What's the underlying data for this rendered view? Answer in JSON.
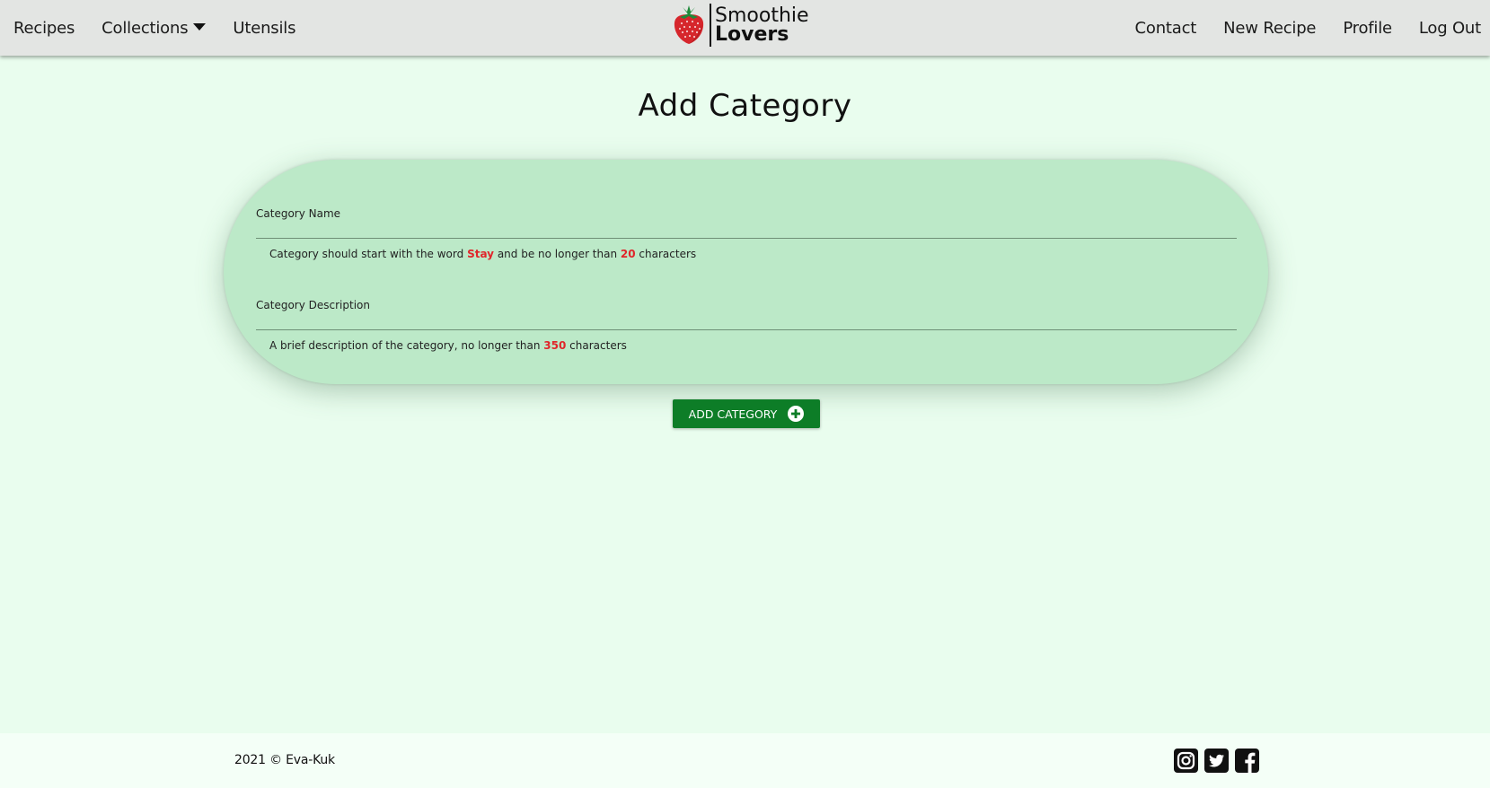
{
  "nav": {
    "left": {
      "recipes": "Recipes",
      "collections": "Collections",
      "utensils": "Utensils"
    },
    "brand": {
      "line1": "Smoothie",
      "line2": "Lovers",
      "logo_icon": "strawberry-icon"
    },
    "right": {
      "contact": "Contact",
      "new_recipe": "New Recipe",
      "profile": "Profile",
      "logout": "Log Out"
    }
  },
  "main": {
    "title": "Add Category",
    "fields": {
      "name": {
        "label": "Category Name",
        "value": "",
        "helper": {
          "pre": "Category should start with the word ",
          "word": "Stay",
          "mid": " and be no longer than ",
          "limit": "20",
          "post": " characters"
        }
      },
      "description": {
        "label": "Category Description",
        "value": "",
        "helper": {
          "pre": "A brief description of the category, no longer than ",
          "limit": "350",
          "post": " characters"
        }
      }
    },
    "submit": {
      "label": "ADD CATEGORY",
      "icon": "plus-circle-icon"
    }
  },
  "footer": {
    "copyright": "2021 © Eva-Kuk",
    "socials": [
      "instagram-icon",
      "twitter-icon",
      "facebook-icon"
    ]
  },
  "colors": {
    "background": "#e9fdee",
    "navbar": "#e3e5e3",
    "card": "#bce9c8",
    "button": "#0d7d27",
    "highlight": "#e0262b",
    "footer": "#f4fff7"
  }
}
